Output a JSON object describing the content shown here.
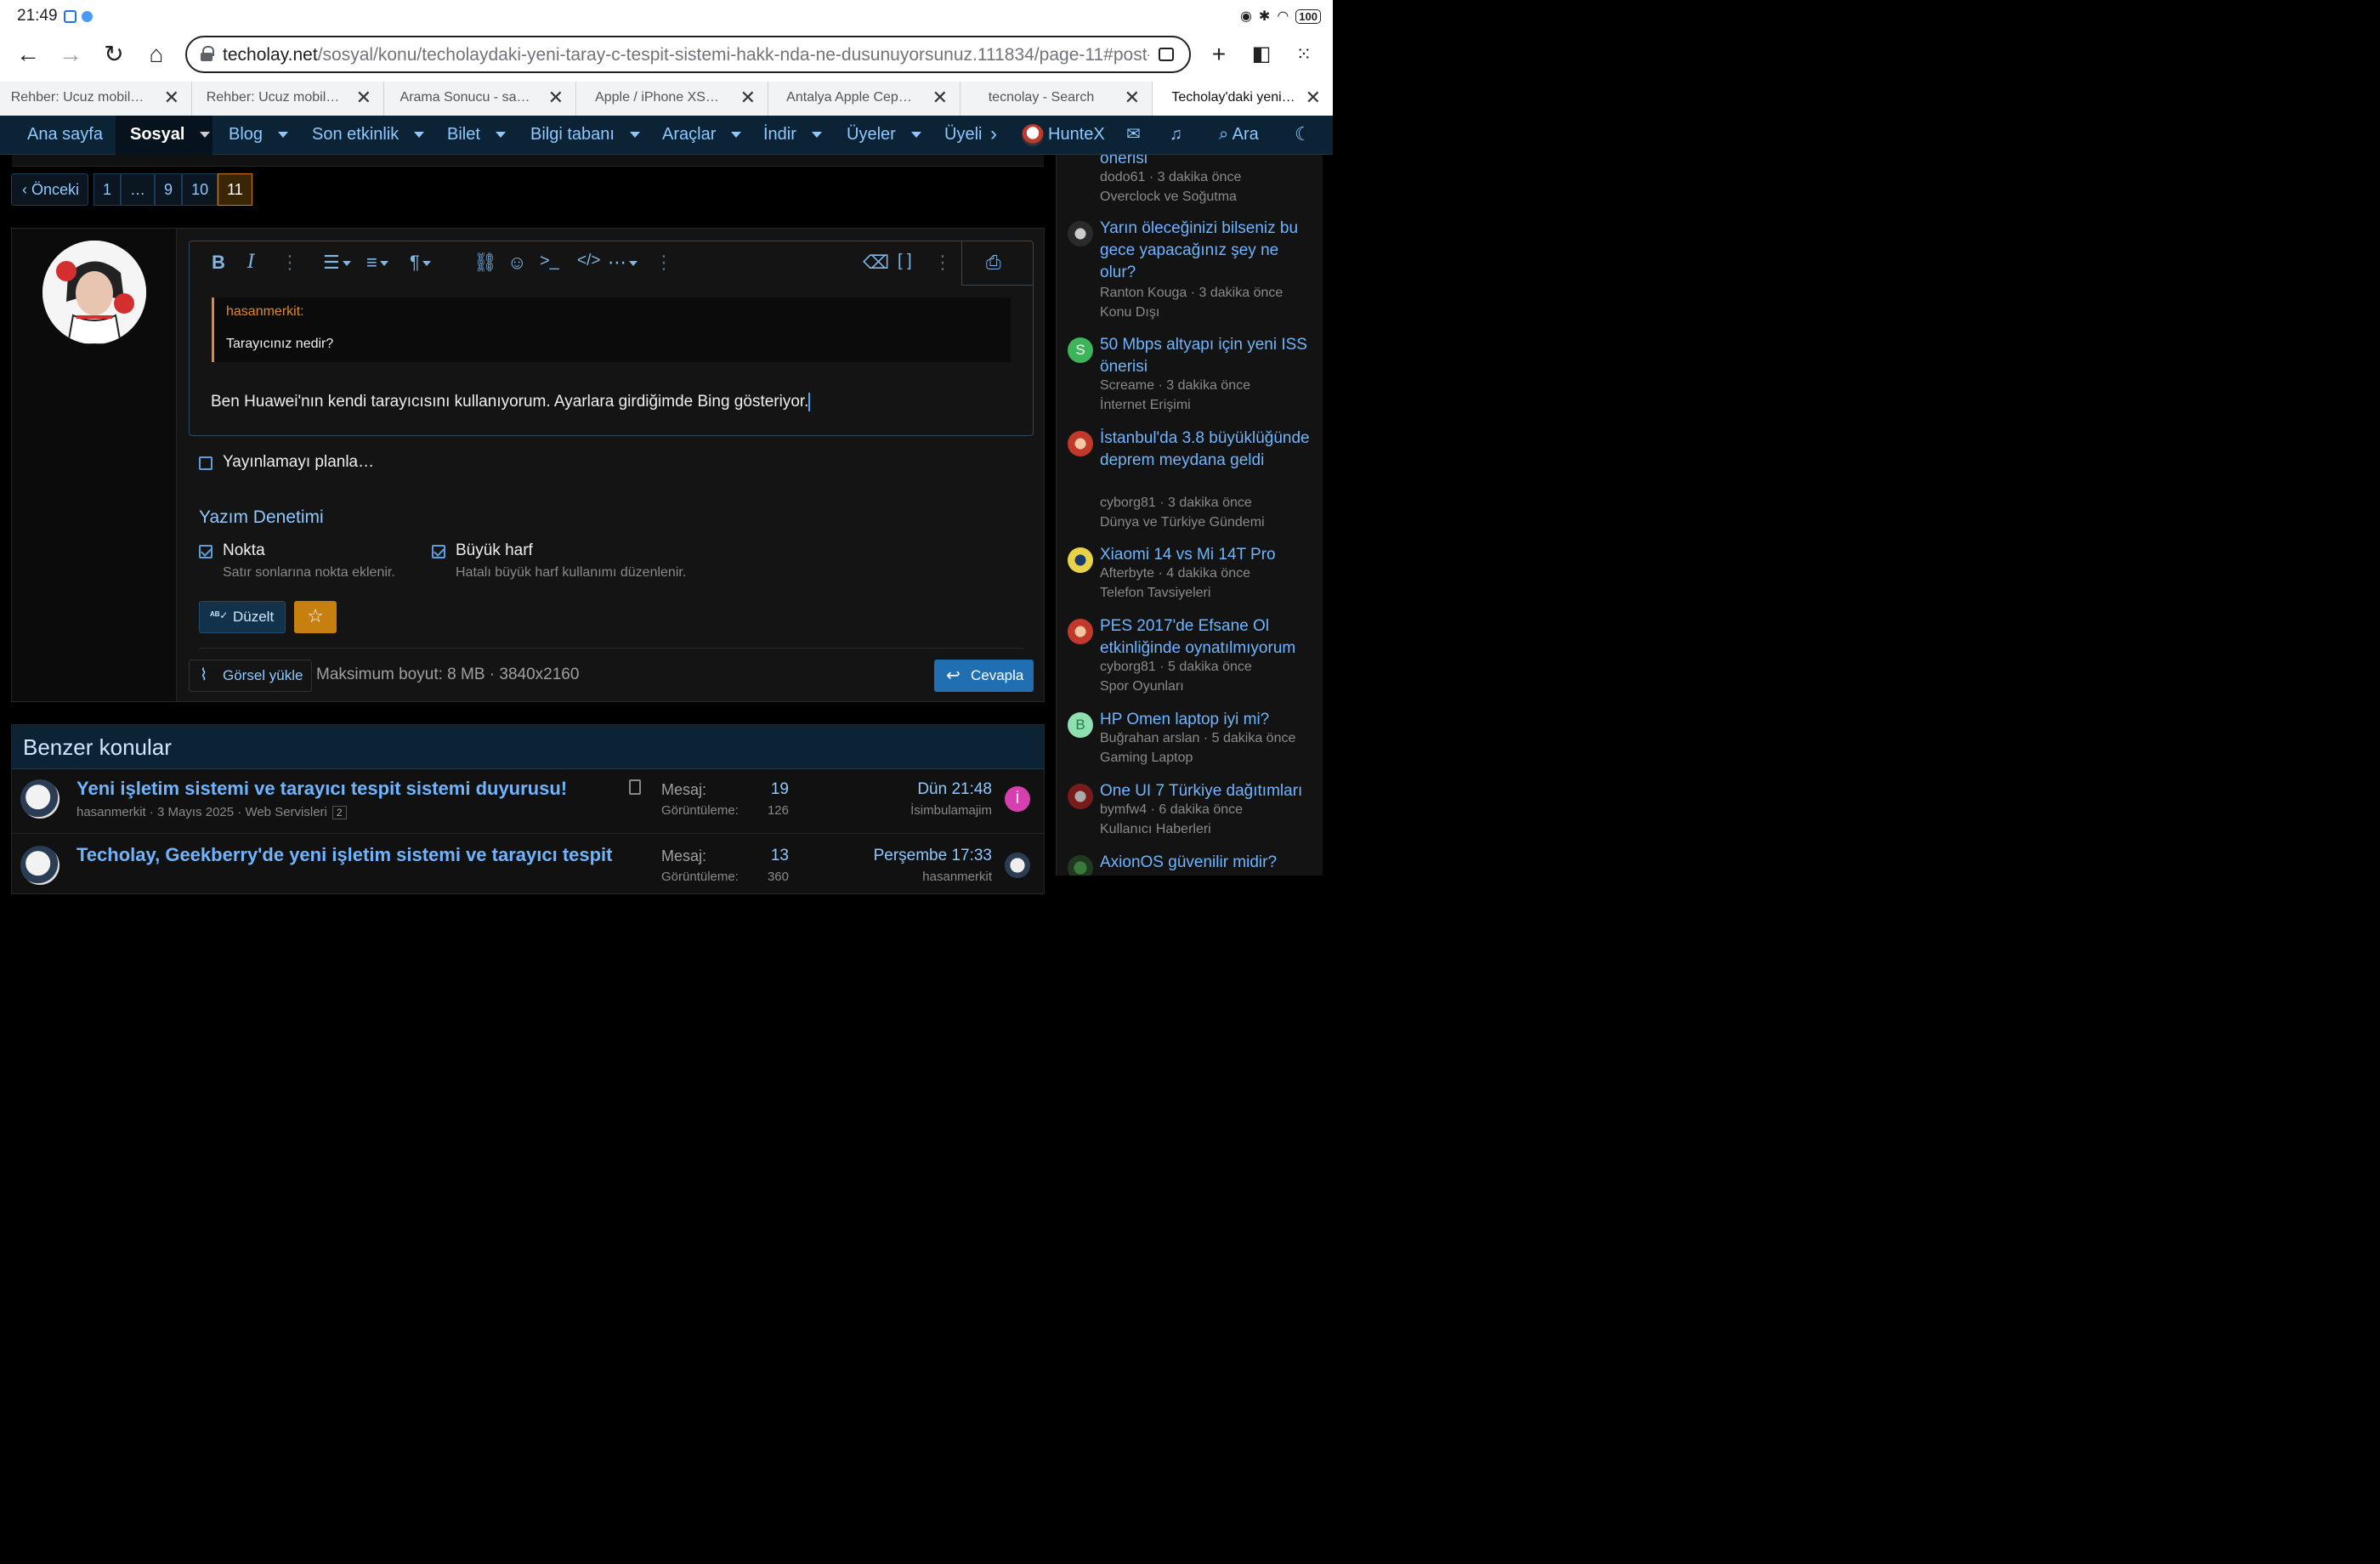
{
  "status": {
    "time": "21:49",
    "battery": "100"
  },
  "browser": {
    "url_host": "techolay.net",
    "url_path": "/sosyal/konu/techolaydaki-yeni-taray-c-tespit-sistemi-hakk-nda-ne-dusunuyorsunuz.111834/page-11#post-",
    "tabs": [
      {
        "title": "Rehber: Ucuz mobil…"
      },
      {
        "title": "Rehber: Ucuz mobil…"
      },
      {
        "title": "Arama Sonucu - sa…"
      },
      {
        "title": "Apple / iPhone XS…"
      },
      {
        "title": "Antalya Apple Cep…"
      },
      {
        "title": "tecnolay - Search"
      },
      {
        "title": "Techolay'daki yeni…"
      }
    ]
  },
  "nav": {
    "items": [
      "Ana sayfa",
      "Sosyal",
      "Blog",
      "Son etkinlik",
      "Bilet",
      "Bilgi tabanı",
      "Araçlar",
      "İndir",
      "Üyeler",
      "Üyeli"
    ],
    "user": "HunteX",
    "search": "Ara"
  },
  "pager": {
    "prev": "Önceki",
    "pages": [
      "1",
      "…",
      "9",
      "10",
      "11"
    ],
    "current": "11"
  },
  "editor": {
    "quote_author": "hasanmerkit:",
    "quote_text": "Tarayıcınız nedir?",
    "body": "Ben Huawei'nın kendi tarayıcısını kullanıyorum. Ayarlara girdiğimde Bing gösteriyor."
  },
  "schedule_label": "Yayınlamayı planla…",
  "spell": {
    "title": "Yazım Denetimi",
    "dot_label": "Nokta",
    "dot_hint": "Satır sonlarına nokta eklenir.",
    "caps_label": "Büyük harf",
    "caps_hint": "Hatalı büyük harf kullanımı düzenlenir.",
    "fix_button": "Düzelt"
  },
  "upload": {
    "button": "Görsel yükle",
    "info": "Maksimum boyut: 8 MB · 3840x2160"
  },
  "reply_button": "Cevapla",
  "similar": {
    "title": "Benzer konular",
    "rows": [
      {
        "title": "Yeni işletim sistemi ve tarayıcı tespit sistemi duyurusu!",
        "author": "hasanmerkit",
        "date": "3 Mayıs 2025",
        "forum": "Web Servisleri",
        "pages": "2",
        "msg_label": "Mesaj:",
        "messages": "19",
        "view_label": "Görüntüleme:",
        "views": "126",
        "last": "Dün 21:48",
        "last_user": "İsimbulamajim",
        "last_initial": "İ"
      },
      {
        "title": "Techolay, Geekberry'de yeni işletim sistemi ve tarayıcı tespit",
        "msg_label": "Mesaj:",
        "messages": "13",
        "view_label": "Görüntüleme:",
        "views": "360",
        "last": "Perşembe 17:33",
        "last_user": "hasanmerkit"
      }
    ]
  },
  "sidebar": {
    "threads": [
      {
        "title": "önerisi",
        "user": "dodo61",
        "time": "3 dakika önce",
        "forum": "Overclock ve Soğutma"
      },
      {
        "title": "Yarın öleceğinizi bilseniz bu gece yapacağınız şey ne olur?",
        "user": "Ranton Kouga",
        "time": "3 dakika önce",
        "forum": "Konu Dışı"
      },
      {
        "title": "50 Mbps altyapı için yeni ISS önerisi",
        "user": "Screame",
        "time": "3 dakika önce",
        "forum": "İnternet Erişimi",
        "initial": "S"
      },
      {
        "title": "İstanbul'da 3.8 büyüklüğünde deprem meydana geldi",
        "user": "cyborg81",
        "time": "3 dakika önce",
        "forum": "Dünya ve Türkiye Gündemi"
      },
      {
        "title": "Xiaomi 14 vs Mi 14T Pro",
        "user": "Afterbyte",
        "time": "4 dakika önce",
        "forum": "Telefon Tavsiyeleri"
      },
      {
        "title": "PES 2017'de Efsane Ol etkinliğinde oynatılmıyorum",
        "user": "cyborg81",
        "time": "5 dakika önce",
        "forum": "Spor Oyunları"
      },
      {
        "title": "HP Omen laptop iyi mi?",
        "user": "Buğrahan arslan",
        "time": "5 dakika önce",
        "forum": "Gaming Laptop",
        "initial": "B"
      },
      {
        "title": "One UI 7 Türkiye dağıtımları",
        "user": "bymfw4",
        "time": "6 dakika önce",
        "forum": "Kullanıcı Haberleri"
      },
      {
        "title": "AxionOS güvenilir midir?"
      }
    ]
  }
}
